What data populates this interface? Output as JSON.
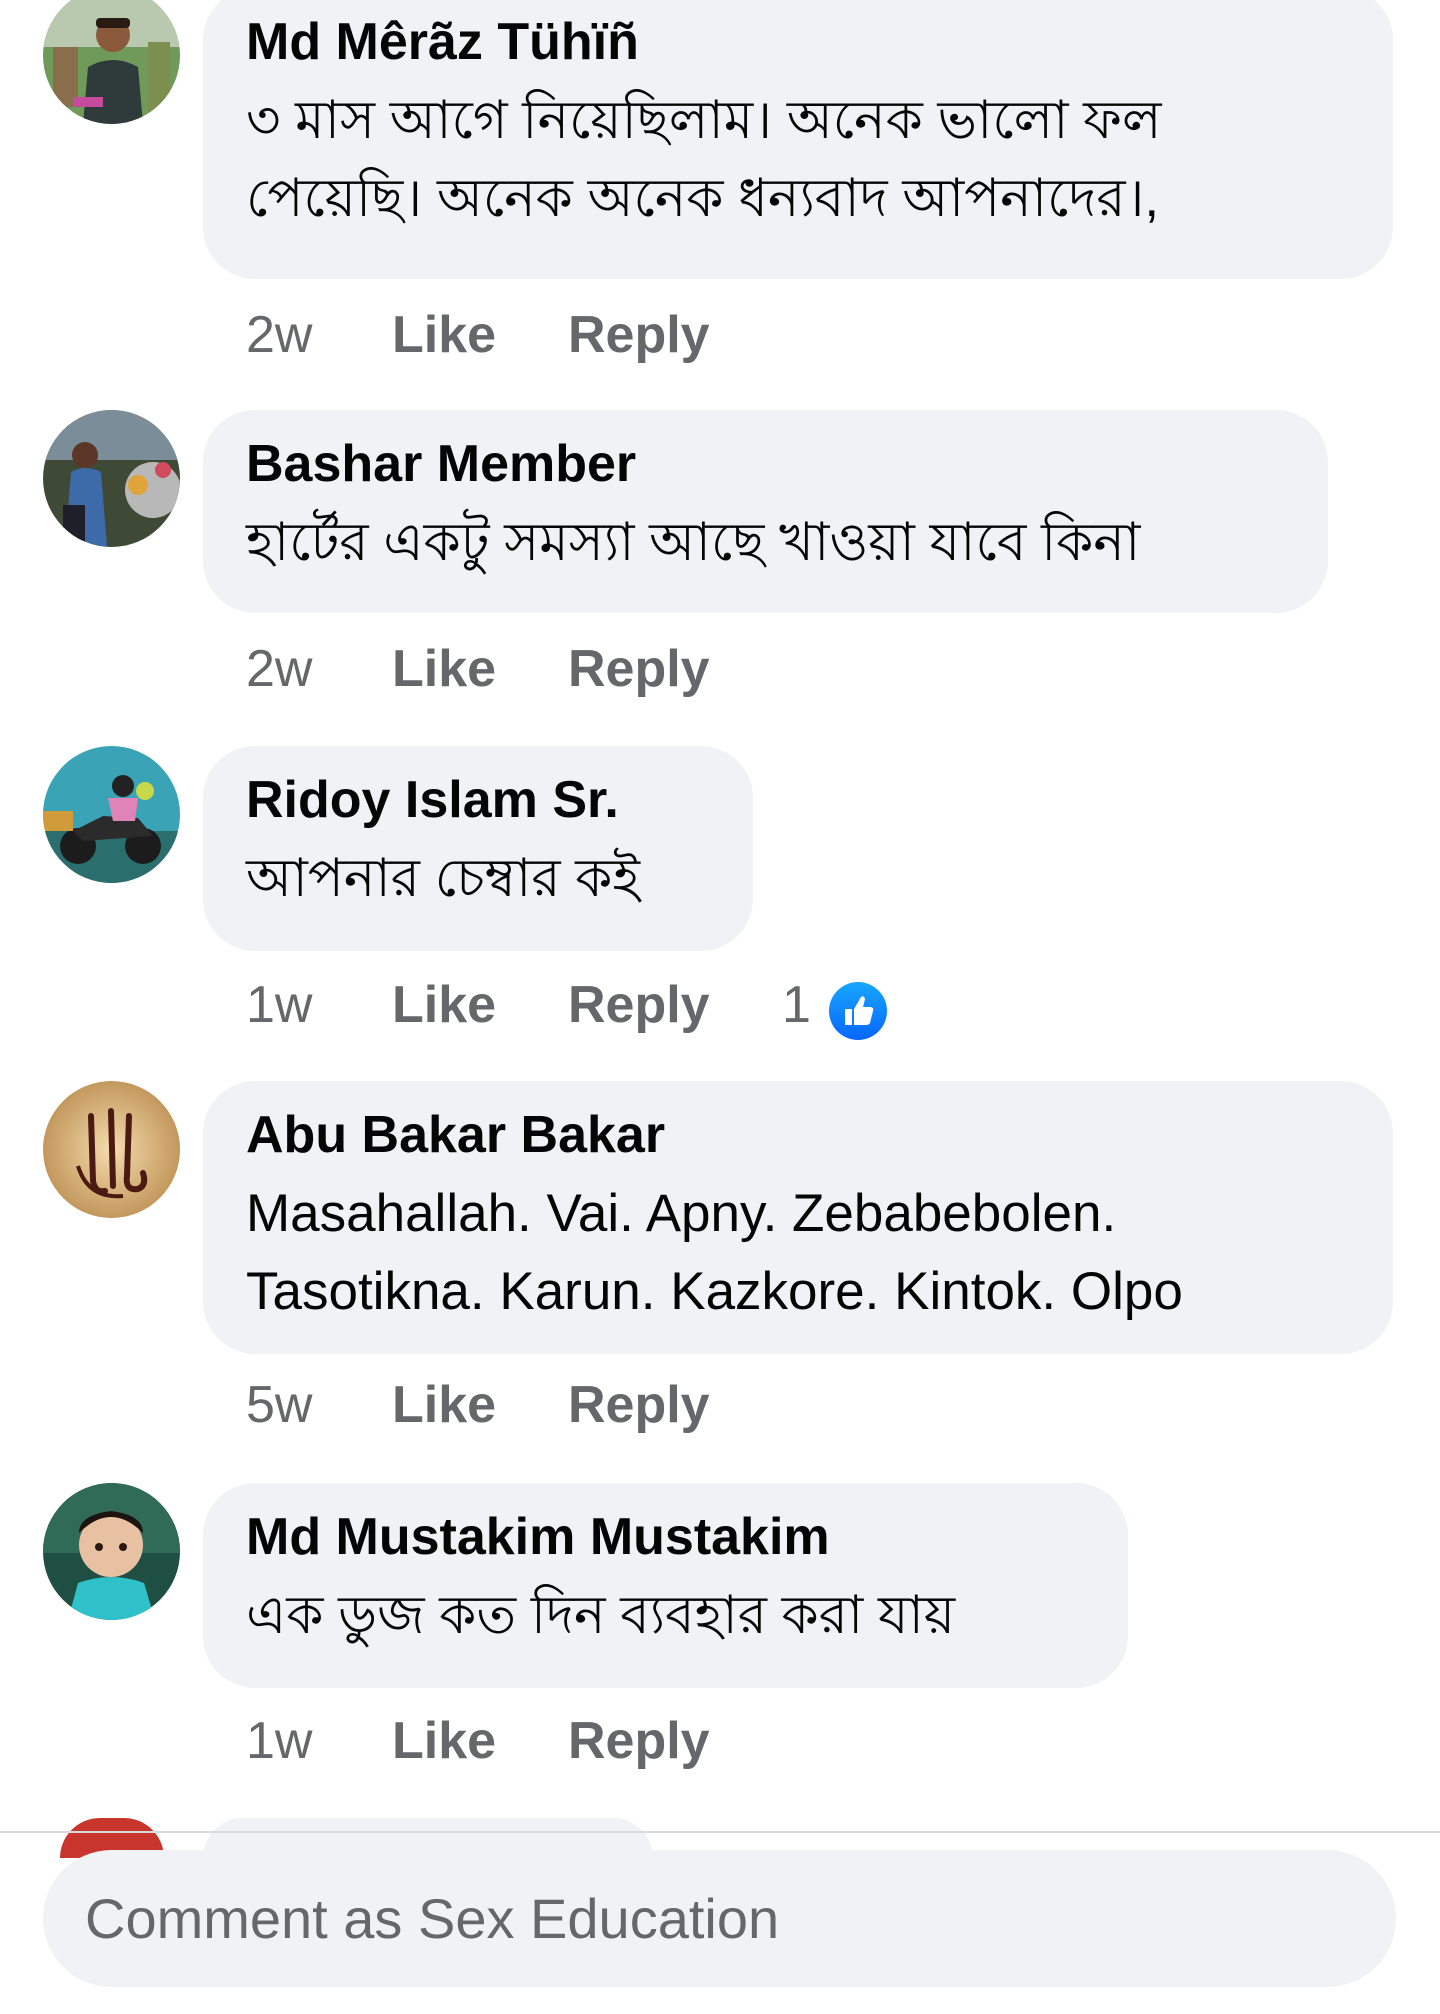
{
  "comments": [
    {
      "author": "Md Mêrãz Tühïñ",
      "text": "৩ মাস আগে নিয়েছিলাম। অনেক ভালো ফল\nপেয়েছি।  অনেক অনেক ধন্যবাদ আপনাদের।,",
      "time": "2w",
      "like": "Like",
      "reply": "Reply",
      "avatar_icon": "person-photo"
    },
    {
      "author": "Bashar Member",
      "text": "হার্টের একটু সমস্যা আছে খাওয়া যাবে কিনা",
      "time": "2w",
      "like": "Like",
      "reply": "Reply",
      "avatar_icon": "person-photo"
    },
    {
      "author": "Ridoy Islam Sr.",
      "text": "আপনার চেম্বার কই",
      "time": "1w",
      "like": "Like",
      "reply": "Reply",
      "reaction_count": "1",
      "reaction_icon": "thumbs-up-icon",
      "avatar_icon": "motorbike-photo"
    },
    {
      "author": "Abu Bakar Bakar",
      "text": "Masahallah. Vai. Apny. Zebabebolen.\nTasotikna. Karun. Kazkore. Kintok. Olpo",
      "time": "5w",
      "like": "Like",
      "reply": "Reply",
      "avatar_icon": "calligraphy-emblem"
    },
    {
      "author": "Md Mustakim Mustakim",
      "text": "এক ডুজ কত দিন ব্যবহার করা যায়",
      "time": "1w",
      "like": "Like",
      "reply": "Reply",
      "avatar_icon": "child-photo"
    }
  ],
  "composer": {
    "placeholder": "Comment as Sex Education"
  },
  "colors": {
    "bubble": "#f0f2f5",
    "meta_text": "#65676b",
    "reaction_blue": "#0866ff"
  }
}
